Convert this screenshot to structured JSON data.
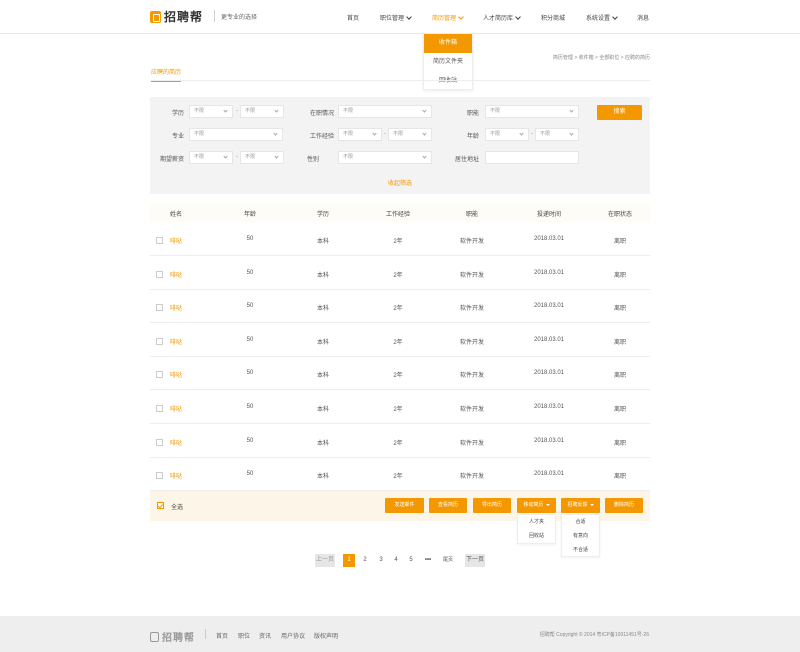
{
  "header": {
    "logo_text": "招聘帮",
    "slogan": "更专业的选择",
    "nav": [
      {
        "label": "首页",
        "has_caret": false,
        "active": false
      },
      {
        "label": "职位管理",
        "has_caret": true,
        "active": false
      },
      {
        "label": "简历管理",
        "has_caret": true,
        "active": true
      },
      {
        "label": "人才简历库",
        "has_caret": true,
        "active": false
      },
      {
        "label": "积分商城",
        "has_caret": false,
        "active": false
      },
      {
        "label": "系统设置",
        "has_caret": true,
        "active": false
      },
      {
        "label": "消息",
        "has_caret": false,
        "active": false
      }
    ],
    "resume_menu": [
      "收件箱",
      "简历文件夹",
      "回收站"
    ]
  },
  "breadcrumb": "简历管理 > 收件箱 > 全部职位 > 应聘的简历",
  "tab": "应聘的简历",
  "filters": {
    "education_label": "学历",
    "education_from": "不限",
    "education_to": "不限",
    "job_status_label": "在职情况",
    "job_status_value": "不限",
    "position_label": "职能",
    "position_value": "不限",
    "search_button": "搜索",
    "major_label": "专业",
    "major_value": "不限",
    "work_exp_label": "工作经验",
    "work_exp_from": "不限",
    "work_exp_to": "不限",
    "age_label": "年龄",
    "age_from": "不限",
    "age_to": "不限",
    "salary_label": "期望薪资",
    "salary_from": "不限",
    "salary_to": "不限",
    "gender_label": "性别",
    "gender_value": "不限",
    "address_label": "居住地址",
    "address_value": "",
    "collapse": "收起筛选"
  },
  "table": {
    "headers": [
      "姓名",
      "年龄",
      "学历",
      "工作经验",
      "职能",
      "投递时间",
      "在职状态"
    ],
    "rows": [
      {
        "name": "啡哒",
        "age": "50",
        "education": "本科",
        "experience": "2年",
        "position": "软件开发",
        "date": "2018.03.01",
        "status": "离职"
      },
      {
        "name": "啡哒",
        "age": "50",
        "education": "本科",
        "experience": "2年",
        "position": "软件开发",
        "date": "2018.03.01",
        "status": "离职"
      },
      {
        "name": "啡哒",
        "age": "50",
        "education": "本科",
        "experience": "2年",
        "position": "软件开发",
        "date": "2018.03.01",
        "status": "离职"
      },
      {
        "name": "啡哒",
        "age": "50",
        "education": "本科",
        "experience": "2年",
        "position": "软件开发",
        "date": "2018.03.01",
        "status": "离职"
      },
      {
        "name": "啡哒",
        "age": "50",
        "education": "本科",
        "experience": "2年",
        "position": "软件开发",
        "date": "2018.03.01",
        "status": "离职"
      },
      {
        "name": "啡哒",
        "age": "50",
        "education": "本科",
        "experience": "2年",
        "position": "软件开发",
        "date": "2018.03.01",
        "status": "离职"
      },
      {
        "name": "啡哒",
        "age": "50",
        "education": "本科",
        "experience": "2年",
        "position": "软件开发",
        "date": "2018.03.01",
        "status": "离职"
      },
      {
        "name": "啡哒",
        "age": "50",
        "education": "本科",
        "experience": "2年",
        "position": "软件开发",
        "date": "2018.03.01",
        "status": "离职"
      }
    ]
  },
  "actions": {
    "select_all": "全选",
    "send_email": "发送邮件",
    "view_resume": "查看简历",
    "export_resume": "导出简历",
    "move_resume": "移动简历",
    "feedback": "招聘反馈",
    "delete_resume": "删除简历",
    "move_menu": [
      "人才夹",
      "回收站"
    ],
    "feedback_menu": [
      "合适",
      "有意向",
      "不合适"
    ]
  },
  "pagination": {
    "prev": "上一页",
    "pages": [
      "1",
      "2",
      "3",
      "4",
      "5"
    ],
    "ellipsis": "•••",
    "last": "尾页",
    "next": "下一页",
    "current": "1"
  },
  "footer": {
    "logo_text": "招聘帮",
    "links": [
      "首页",
      "职位",
      "资讯",
      "用户协议",
      "版权声明"
    ],
    "copyright": "招聘帮 Copyright © 2014 粤ICP备10011451号-26"
  },
  "colors": {
    "accent": "#f39800",
    "filter_bg": "#f3f3f3",
    "footer_bg": "#eeeeee"
  }
}
